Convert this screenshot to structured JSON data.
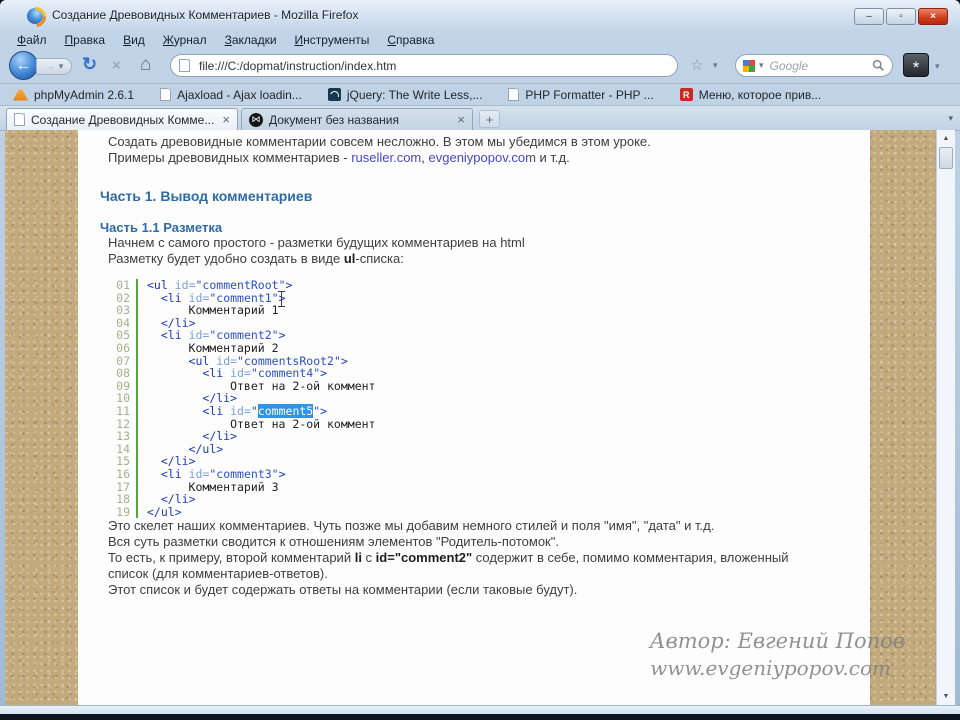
{
  "window": {
    "title": "Создание Древовидных Комментариев - Mozilla Firefox",
    "controls": {
      "minimize": "–",
      "maximize": "▫",
      "close": "×"
    }
  },
  "icons": {
    "back": "←",
    "forward": "→",
    "reload": "↻",
    "stop": "×",
    "home": "⌂",
    "star": "☆",
    "caret": "▾",
    "addon": "*",
    "new_tab": "+",
    "all_tabs": "▾",
    "scroll_up": "▲",
    "scroll_down": "▼",
    "close_tab": "×",
    "bowtie": "⋈"
  },
  "menubar": {
    "items": [
      {
        "name": "file",
        "key": "Ф",
        "rest": "айл"
      },
      {
        "name": "edit",
        "key": "П",
        "rest": "равка"
      },
      {
        "name": "view",
        "key": "В",
        "rest": "ид"
      },
      {
        "name": "history",
        "key": "Ж",
        "rest": "урнал"
      },
      {
        "name": "bookmarks",
        "key": "З",
        "rest": "акладки"
      },
      {
        "name": "tools",
        "key": "И",
        "rest": "нструменты"
      },
      {
        "name": "help",
        "key": "С",
        "rest": "правка"
      }
    ]
  },
  "navbar": {
    "url": "file:///C:/dopmat/instruction/index.htm",
    "search_placeholder": "Google"
  },
  "bookmarks": [
    {
      "label": "phpMyAdmin 2.6.1",
      "icon": "phpmyadmin"
    },
    {
      "label": "Ajaxload - Ajax loadin...",
      "icon": "page"
    },
    {
      "label": "jQuery: The Write Less,...",
      "icon": "jquery"
    },
    {
      "label": "PHP Formatter - PHP ...",
      "icon": "page"
    },
    {
      "label": "Меню, которое прив...",
      "icon": "r-badge",
      "badge": "R"
    }
  ],
  "tabs": [
    {
      "title": "Создание Древовидных Комме...",
      "icon": "page",
      "active": true
    },
    {
      "title": "Документ без названия",
      "icon": "doc-app",
      "active": false
    }
  ],
  "content": {
    "paragraphs": {
      "p1": [
        {
          "text": "Создать древовидные комментарии совсем несложно. В этом мы убедимся в этом уроке."
        }
      ],
      "p2": [
        {
          "text": "Примеры древовидных комментариев - "
        },
        {
          "text": "ruseller.com",
          "style": "link"
        },
        {
          "text": ", "
        },
        {
          "text": "evgeniypopov.com",
          "style": "link"
        },
        {
          "text": " и т.д."
        }
      ],
      "h1": "Часть 1. Вывод комментариев",
      "h2": "Часть 1.1 Разметка",
      "p3": [
        {
          "text": "Начнем с самого простого - разметки будущих комментариев на html"
        }
      ],
      "p4": [
        {
          "text": "Разметку будет удобно создать в виде "
        },
        {
          "text": "ul",
          "style": "bold"
        },
        {
          "text": "-списка:"
        }
      ],
      "p5": [
        {
          "text": "Это скелет наших комментариев. Чуть позже мы добавим немного стилей и поля \"имя\", \"дата\" и т.д."
        }
      ],
      "p6": [
        {
          "text": "Вся суть разметки сводится к отношениям элементов \"Родитель-потомок\"."
        }
      ],
      "p7": [
        {
          "text": "То есть, к примеру, второй комментарий "
        },
        {
          "text": "li",
          "style": "bold"
        },
        {
          "text": " с "
        },
        {
          "text": "id=\"comment2\"",
          "style": "bold"
        },
        {
          "text": " содержит в себе, помимо комментария, вложенный список (для комментариев-ответов)."
        }
      ],
      "p8": [
        {
          "text": "Этот список и будет содержать ответы на комментарии (если таковые будут)."
        }
      ]
    },
    "code": {
      "lines": [
        "<ul id=\"commentRoot\">",
        "  <li id=\"comment1\">",
        "      Комментарий 1",
        "  </li>",
        "  <li id=\"comment2\">",
        "      Комментарий 2",
        "      <ul id=\"commentsRoot2\">",
        "        <li id=\"comment4\">",
        "            Ответ на 2-ой коммент",
        "        </li>",
        "        <li id=\"comment5\">",
        "            Ответ на 2-ой коммент",
        "        </li>",
        "      </ul>",
        "  </li>",
        "  <li id=\"comment3\">",
        "      Комментарий 3",
        "  </li>",
        "</ul>"
      ],
      "selection": {
        "line": 11,
        "text": "comment5"
      }
    },
    "watermark": {
      "line1": "Автор: Евгений Попов",
      "line2": "www.evgeniypopov.com"
    }
  }
}
